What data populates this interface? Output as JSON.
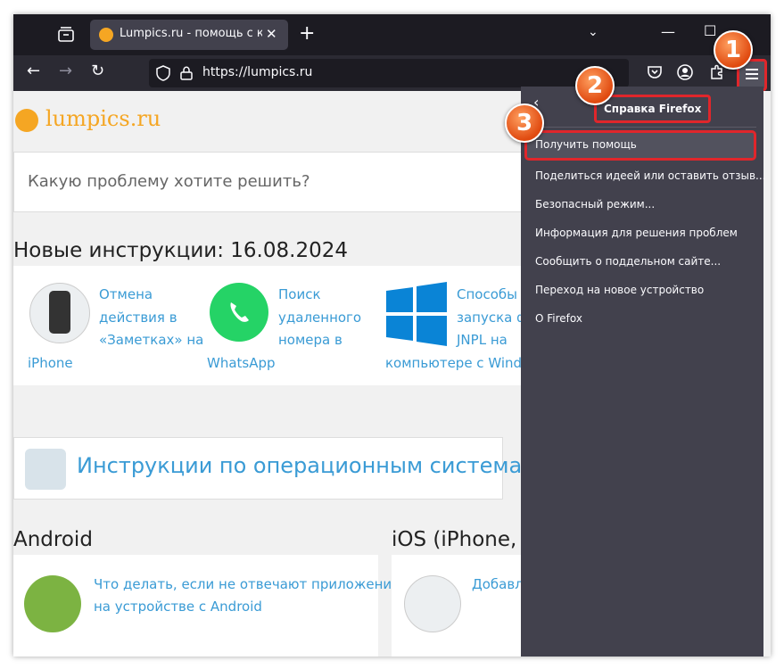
{
  "tab": {
    "title": "Lumpics.ru - помощь с компь"
  },
  "urlbar": {
    "url": "https://lumpics.ru"
  },
  "site": {
    "logo_text": "lumpics.ru",
    "search_placeholder": "Какую проблему хотите решить?",
    "new_heading": "Новые инструкции: 16.08.2024",
    "cards": [
      {
        "lines": [
          "Отмена",
          "действия в",
          "«Заметках» на",
          "iPhone"
        ]
      },
      {
        "lines": [
          "Поиск",
          "удаленного",
          "номера в",
          "WhatsApp"
        ]
      },
      {
        "lines": [
          "Способы",
          "запуска фа",
          "JNPL на",
          "компьютере с Windo"
        ]
      }
    ],
    "os_section": "Инструкции по операционным системам",
    "android": {
      "title": "Android",
      "link_line1": "Что делать, если не отвечают приложения",
      "link_line2": "на устройстве с Android"
    },
    "ios": {
      "title": "iOS (iPhone, iP",
      "link": "Добавл"
    }
  },
  "menu": {
    "title": "Справка Firefox",
    "items": [
      "Получить помощь",
      "Поделиться идеей или оставить отзыв...",
      "Безопасный режим...",
      "Информация для решения проблем",
      "Сообщить о поддельном сайте...",
      "Переход на новое устройство",
      "О Firefox"
    ]
  },
  "steps": [
    "1",
    "2",
    "3"
  ],
  "icons": [
    "tab-list-icon",
    "favicon-orange",
    "close-icon",
    "plus-icon",
    "chevron-down-icon",
    "minimize-icon",
    "maximize-icon",
    "back-arrow-icon",
    "forward-arrow-icon",
    "reload-icon",
    "shield-icon",
    "lock-icon",
    "pocket-icon",
    "account-icon",
    "extensions-icon",
    "hamburger-menu-icon"
  ],
  "colors": {
    "accent": "#e0262b",
    "brand": "#f5a623",
    "link": "#3a9bd5",
    "menu_bg": "#42414d",
    "chrome_dark": "#1c1b22"
  }
}
